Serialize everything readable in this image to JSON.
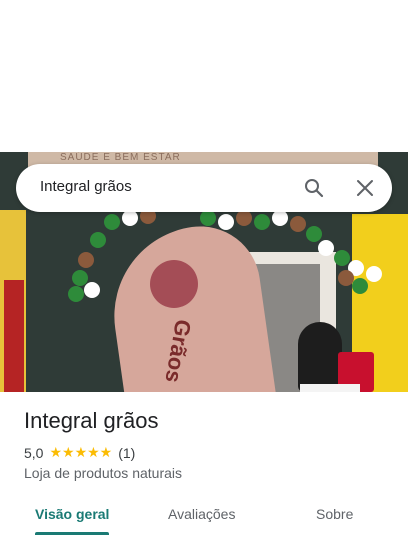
{
  "search": {
    "query": "Integral grãos",
    "icon_search": "search-icon",
    "icon_close": "close-icon"
  },
  "photo": {
    "sign_text": "SAÚDE E BEM ESTAR",
    "flag_text": "Grãos"
  },
  "place": {
    "name": "Integral grãos",
    "rating": "5,0",
    "stars": "★★★★★",
    "review_count": "(1)",
    "category": "Loja de produtos naturais"
  },
  "tabs": [
    {
      "label": "Visão geral",
      "selected": true
    },
    {
      "label": "Avaliações",
      "selected": false
    },
    {
      "label": "Sobre",
      "selected": false
    }
  ],
  "colors": {
    "accent": "#1a7a74",
    "star": "#fbbc04"
  }
}
